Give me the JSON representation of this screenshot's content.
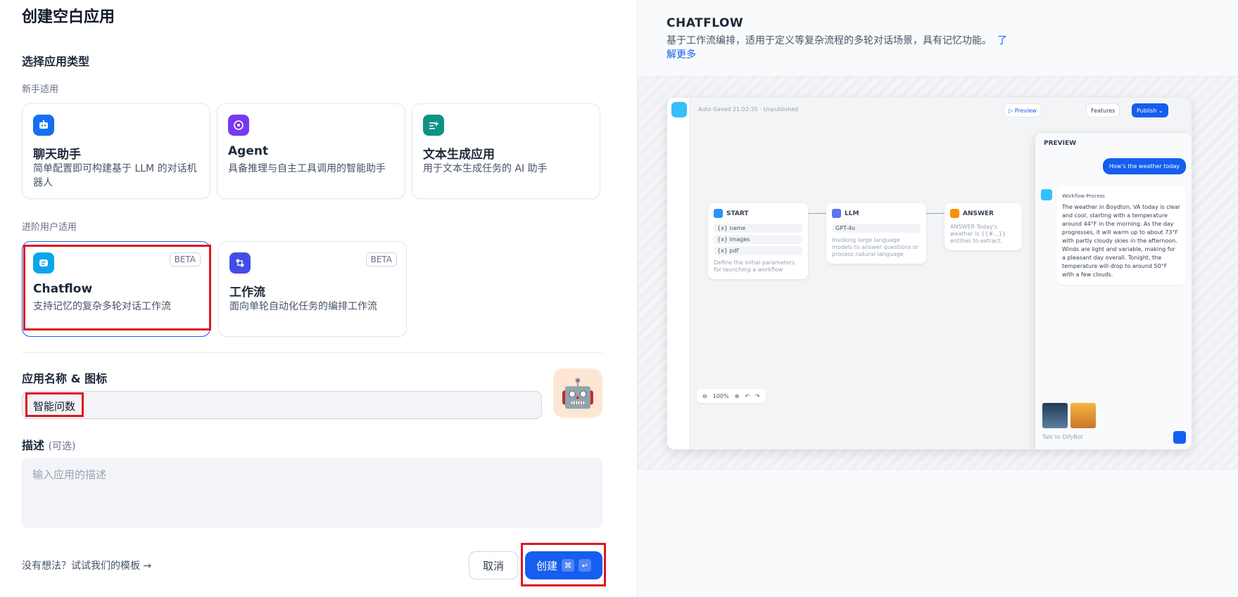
{
  "dialog": {
    "title": "创建空白应用",
    "section_type": "选择应用类型",
    "group_beginner": "新手适用",
    "group_advanced": "进阶用户适用"
  },
  "app_types": [
    {
      "name": "聊天助手",
      "desc": "简单配置即可构建基于 LLM 的对话机器人",
      "icon": "chat-bot-icon",
      "color": "#1570ef"
    },
    {
      "name": "Agent",
      "desc": "具备推理与自主工具调用的智能助手",
      "icon": "agent-icon",
      "color": "#7839ee"
    },
    {
      "name": "文本生成应用",
      "desc": "用于文本生成任务的 AI 助手",
      "icon": "text-generation-icon",
      "color": "#0e9384"
    },
    {
      "name": "Chatflow",
      "desc": "支持记忆的复杂多轮对话工作流",
      "badge": "BETA",
      "icon": "chatflow-icon",
      "color": "#0ba5ec",
      "selected": true
    },
    {
      "name": "工作流",
      "desc": "面向单轮自动化任务的编排工作流",
      "badge": "BETA",
      "icon": "workflow-icon",
      "color": "#444ce7"
    }
  ],
  "form": {
    "name_label": "应用名称 & 图标",
    "name_value": "智能问数",
    "desc_label": "描述",
    "desc_optional": "(可选)",
    "desc_placeholder": "输入应用的描述",
    "avatar_emoji": "🤖",
    "avatar_bg": "#fde7d4"
  },
  "footer": {
    "template_link": "没有想法？试试我们的模板 →",
    "cancel": "取消",
    "create": "创建",
    "kbd1": "⌘",
    "kbd2": "↵"
  },
  "preview": {
    "title": "CHATFLOW",
    "desc": "基于工作流编排，适用于定义等复杂流程的多轮对话场景，具有记忆功能。",
    "learn_more": "了解更多",
    "canvas": {
      "autosave": "Auto-Saved 21:02:35 · Unpublished",
      "btn_preview": "▷ Preview",
      "btn_features": "Features",
      "btn_publish": "Publish ⌄",
      "nodes": [
        {
          "title": "START",
          "rows": [
            "{x} name",
            "{x} images",
            "{x} pdf"
          ],
          "desc": "Define the initial parameters for launching a workflow",
          "color": "#2e90fa"
        },
        {
          "title": "LLM",
          "rows": [
            "GPT-4o"
          ],
          "desc": "Invoking large language models to answer questions or process natural language",
          "color": "#6172f3"
        },
        {
          "title": "ANSWER",
          "rows": [],
          "desc": "ANSWER Today's weather is {{#...}} entities to extract.",
          "color": "#f79009"
        }
      ],
      "zoom": "100%",
      "chat_title": "PREVIEW",
      "question": "How's the weather today",
      "workflow_tag": "Workflow Process",
      "answer": "The weather in Boydton, VA today is clear and cool, starting with a temperature around 44°F in the morning. As the day progresses, it will warm up to about 73°F with partly cloudy skies in the afternoon. Winds are light and variable, making for a pleasant day overall. Tonight, the temperature will drop to around 50°F with a few clouds.",
      "input_placeholder": "Talk to DifyBot"
    }
  }
}
